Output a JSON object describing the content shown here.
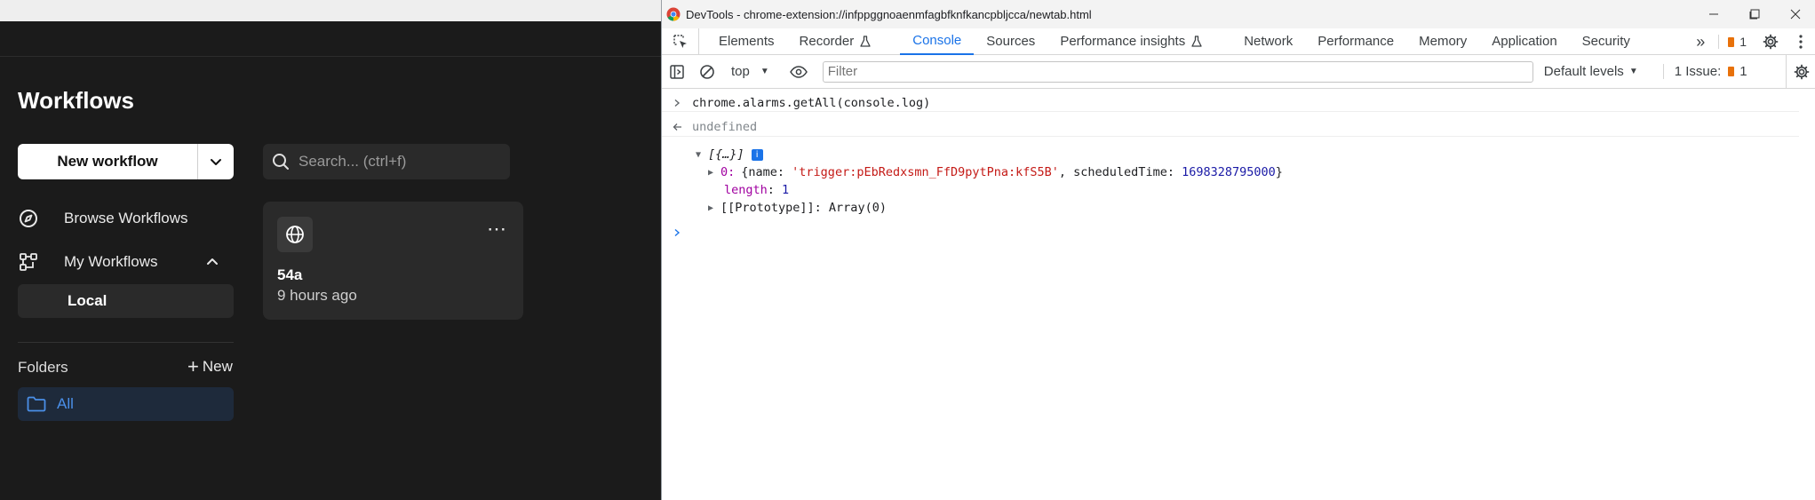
{
  "app": {
    "title": "Workflows",
    "new_workflow_label": "New workflow",
    "search_placeholder": "Search... (ctrl+f)",
    "nav": {
      "browse_label": "Browse Workflows",
      "my_workflows_label": "My Workflows",
      "local_label": "Local"
    },
    "folders": {
      "label": "Folders",
      "new_label": "New",
      "all_label": "All"
    },
    "card": {
      "name": "54a",
      "time": "9 hours ago"
    },
    "colors": {
      "background": "#1b1b1b",
      "folder_accent": "#4a8fe8"
    }
  },
  "devtools": {
    "window_title": "DevTools - chrome-extension://infppggnoaenmfagbfknfkancpbljcca/newtab.html",
    "tabs": [
      "Elements",
      "Recorder",
      "Console",
      "Sources",
      "Performance insights",
      "Network",
      "Performance",
      "Memory",
      "Application",
      "Security"
    ],
    "active_tab": "Console",
    "issues_badge_count": "1",
    "toolbar": {
      "context": "top",
      "filter_placeholder": "Filter",
      "levels": "Default levels",
      "issues_label": "1 Issue:",
      "issues_count": "1"
    },
    "console": {
      "command": "chrome.alarms.getAll(console.log)",
      "result": "undefined",
      "array_summary": "[{…}]",
      "item_index": "0:",
      "item_open": "{name: ",
      "item_name_value": "'trigger:pEbRedxsmn_FfD9pytPna:kfS5B'",
      "item_mid": ", scheduledTime: ",
      "item_time_value": "1698328795000",
      "item_close": "}",
      "length_key": "length",
      "length_value": "1",
      "proto_key": "[[Prototype]]",
      "proto_value": ": Array(0)"
    },
    "colors": {
      "accent": "#1a73e8",
      "string": "#c41a16",
      "number": "#1a1aa6",
      "key": "#a000a0",
      "issue": "#e8710a"
    }
  }
}
